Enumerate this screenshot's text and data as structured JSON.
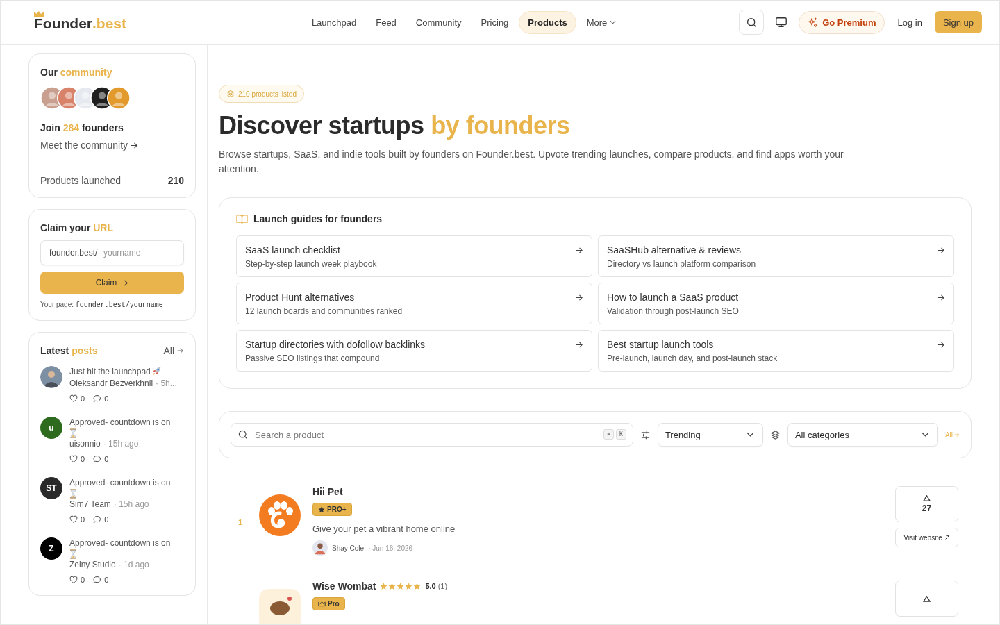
{
  "header": {
    "logo": {
      "name": "Founder",
      "tld": ".best"
    },
    "nav": [
      {
        "label": "Launchpad",
        "selected": false
      },
      {
        "label": "Feed",
        "selected": false
      },
      {
        "label": "Community",
        "selected": false
      },
      {
        "label": "Pricing",
        "selected": false
      },
      {
        "label": "Products",
        "selected": true
      },
      {
        "label": "More",
        "selected": false,
        "kind": "dropdown"
      }
    ],
    "premium": "Go Premium",
    "login": "Log in",
    "signup": "Sign up"
  },
  "community": {
    "title": "Our",
    "title_accent": "community",
    "join": "Join",
    "count": "284",
    "join_tail": "founders",
    "link": "Meet the community",
    "stat_label": "Products launched",
    "stat_value": "210"
  },
  "claim": {
    "title": "Claim your",
    "title_accent": "URL",
    "prefix": "founder.best/",
    "placeholder": "yourname",
    "button": "Claim",
    "note": "Your page:",
    "note_url": "founder.best/yourname"
  },
  "posts": {
    "title": "Latest",
    "title_accent": "posts",
    "all": "All",
    "items": [
      {
        "kind": "launch",
        "text": "Just hit the launchpad",
        "author": "Oleksandr Bezverkhnii",
        "time": "· 5h...",
        "likes": "0",
        "comments": "0",
        "avatar": {
          "kind": "photo"
        }
      },
      {
        "kind": "countdown",
        "text": "Approved- countdown is on",
        "author": "uisonnio",
        "time": "· 15h ago",
        "likes": "0",
        "comments": "0",
        "avatar": {
          "kind": "initials",
          "text": "u",
          "color": "#2f6b1f"
        }
      },
      {
        "kind": "countdown",
        "text": "Approved- countdown is on",
        "author": "Sim7 Team",
        "time": "· 15h ago",
        "likes": "0",
        "comments": "0",
        "avatar": {
          "kind": "initials",
          "text": "ST",
          "color": "#2a2a2a"
        }
      },
      {
        "kind": "countdown",
        "text": "Approved- countdown is on",
        "author": "Zelny Studio",
        "time": "· 1d ago",
        "likes": "0",
        "comments": "0",
        "avatar": {
          "kind": "initials",
          "text": "Z",
          "color": "#000000"
        }
      }
    ]
  },
  "hero": {
    "badge": "210 products listed",
    "title": "Discover startups",
    "title_accent": "by founders",
    "description": "Browse startups, SaaS, and indie tools built by founders on Founder.best. Upvote trending launches, compare products, and find apps worth your attention."
  },
  "guides": {
    "title": "Launch guides for founders",
    "items": [
      {
        "title": "SaaS launch checklist",
        "subtitle": "Step-by-step launch week playbook"
      },
      {
        "title": "SaaSHub alternative & reviews",
        "subtitle": "Directory vs launch platform comparison"
      },
      {
        "title": "Product Hunt alternatives",
        "subtitle": "12 launch boards and communities ranked"
      },
      {
        "title": "How to launch a SaaS product",
        "subtitle": "Validation through post-launch SEO"
      },
      {
        "title": "Startup directories with dofollow backlinks",
        "subtitle": "Passive SEO listings that compound"
      },
      {
        "title": "Best startup launch tools",
        "subtitle": "Pre-launch, launch day, and post-launch stack"
      }
    ]
  },
  "filters": {
    "search_placeholder": "Search a product",
    "keys": [
      "⌘",
      "K"
    ],
    "sort": "Trending",
    "category": "All categories",
    "all": "All"
  },
  "products": [
    {
      "rank": "1",
      "name": "Hii Pet",
      "badge": {
        "kind": "proplus",
        "label": "PRO+"
      },
      "tagline": "Give your pet a vibrant home online",
      "maker": "Shay Cole",
      "date": "· Jun 16, 2026",
      "votes": "27",
      "visit": "Visit website"
    },
    {
      "name": "Wise Wombat",
      "stars": 5,
      "rating": "5.0",
      "reviews": "(1)",
      "badge": {
        "kind": "pro",
        "label": "Pro"
      }
    }
  ]
}
